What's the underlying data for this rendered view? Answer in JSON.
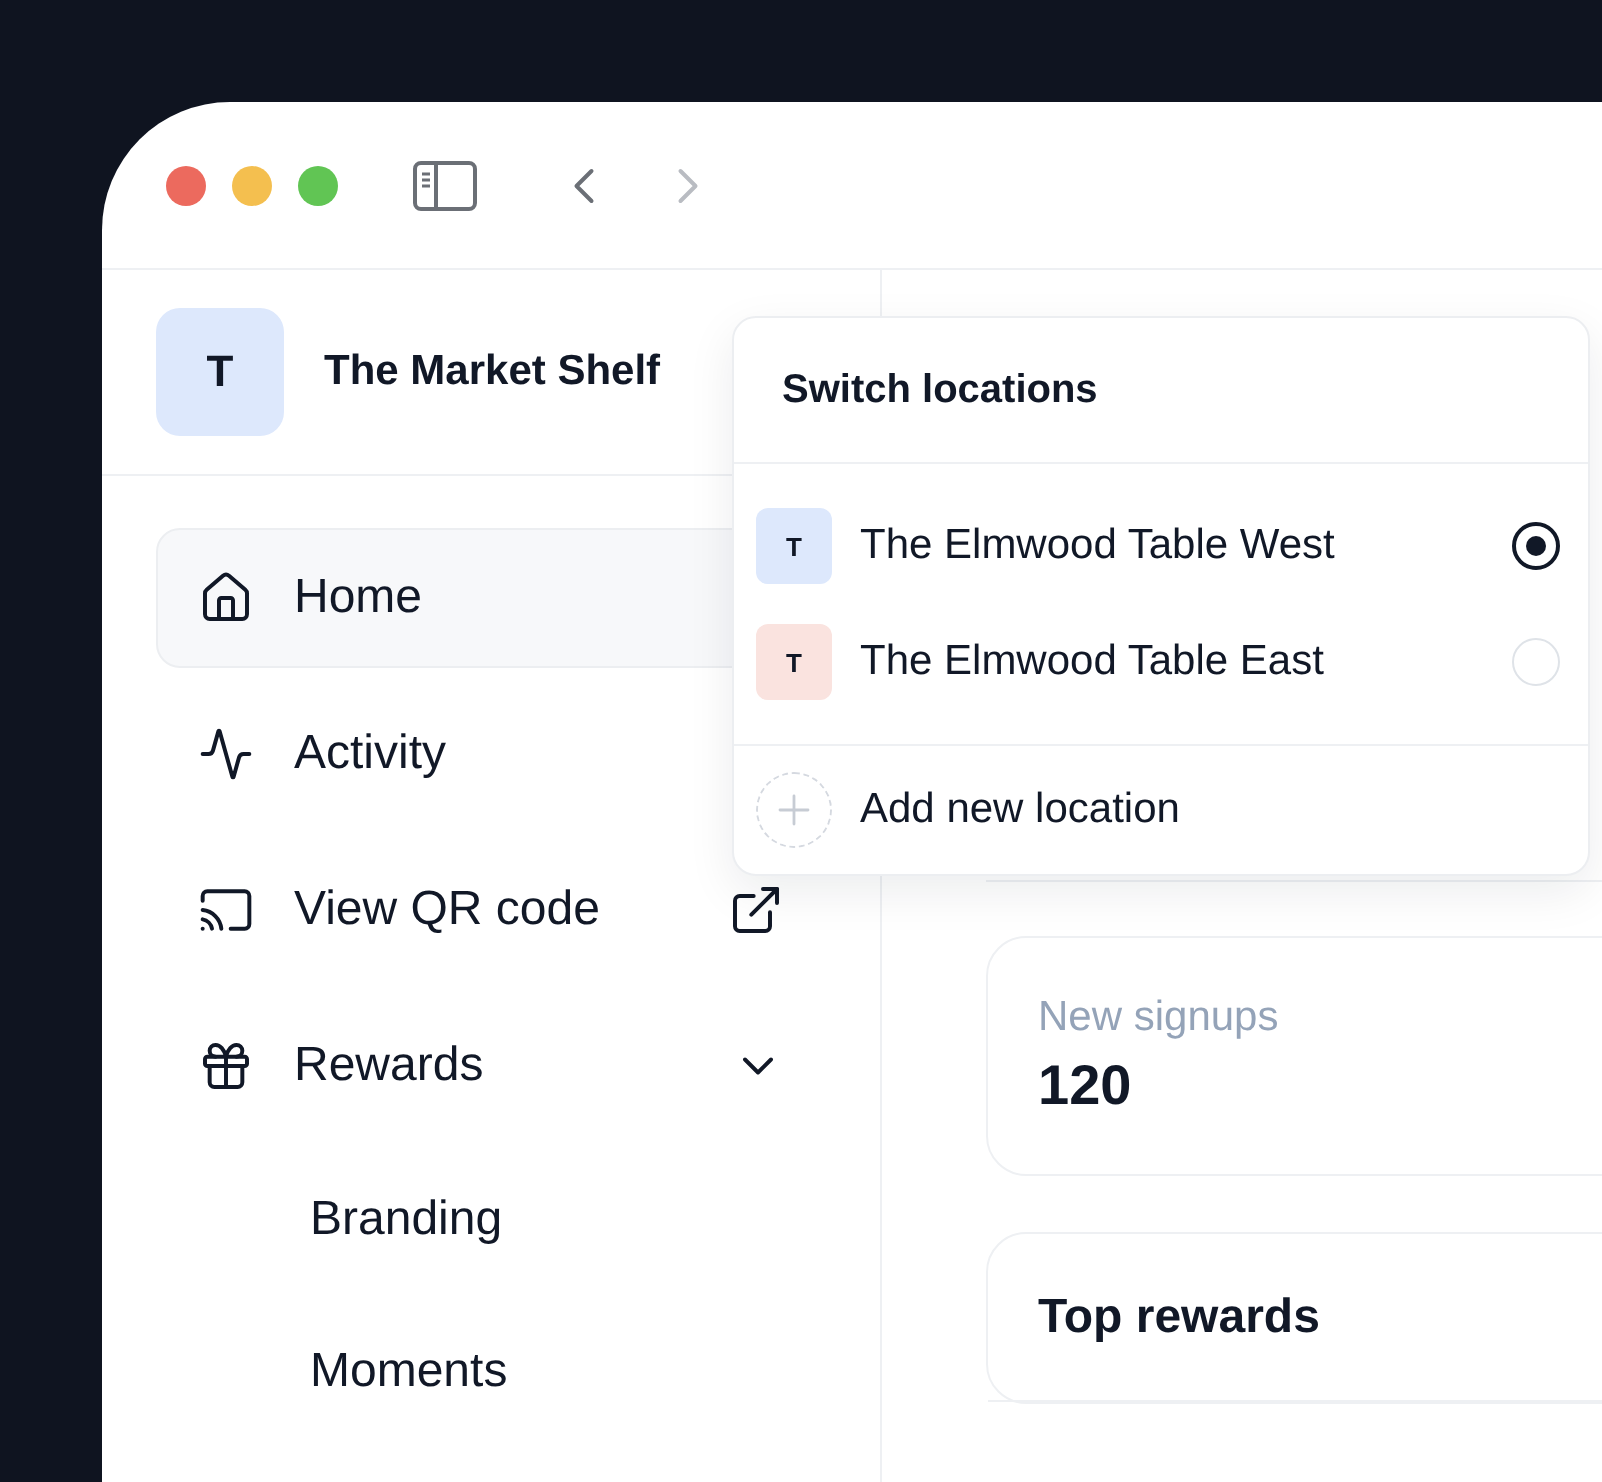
{
  "sidebar": {
    "account": {
      "initial": "T",
      "name": "The Market Shelf"
    },
    "items": [
      {
        "label": "Home",
        "selected": true
      },
      {
        "label": "Activity",
        "selected": false
      },
      {
        "label": "View QR code",
        "selected": false
      },
      {
        "label": "Rewards",
        "selected": false,
        "expanded": true,
        "children": [
          {
            "label": "Branding"
          },
          {
            "label": "Moments"
          }
        ]
      }
    ]
  },
  "location_menu": {
    "title": "Switch locations",
    "locations": [
      {
        "initial": "T",
        "name": "The Elmwood Table West",
        "color": "#dde8fc",
        "selected": true
      },
      {
        "initial": "T",
        "name": "The Elmwood Table East",
        "color": "#fae3df",
        "selected": false
      }
    ],
    "add_label": "Add new location"
  },
  "stats": [
    {
      "label": "New signups",
      "value": "120"
    }
  ],
  "top_rewards": {
    "title": "Top rewards"
  }
}
